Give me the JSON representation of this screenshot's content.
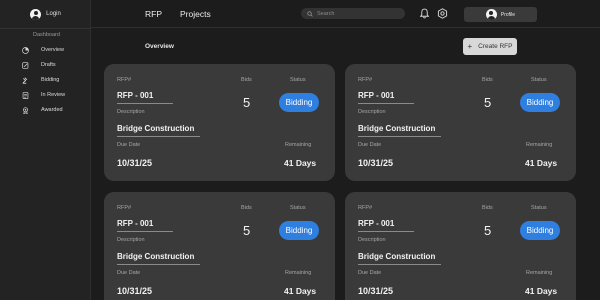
{
  "sidebar": {
    "login_label": "Login",
    "section_label": "Dashboard",
    "items": [
      {
        "label": "Overview",
        "icon": "pie-chart-icon"
      },
      {
        "label": "Drafts",
        "icon": "edit-icon"
      },
      {
        "label": "Bidding",
        "icon": "gavel-icon"
      },
      {
        "label": "In Review",
        "icon": "document-icon"
      },
      {
        "label": "Awarded",
        "icon": "award-icon"
      }
    ]
  },
  "topbar": {
    "tabs": [
      "RFP",
      "Projects"
    ],
    "search_placeholder": "Search",
    "profile_label": "Profile"
  },
  "main": {
    "title": "Overview",
    "create_button_label": "Create RFP",
    "create_button_icon": "+"
  },
  "card_labels": {
    "rfp": "RFP#",
    "bids": "Bids",
    "status": "Status",
    "description": "Description",
    "due_date": "Due Date",
    "remaining": "Remaining"
  },
  "cards": [
    {
      "rfp": "RFP - 001",
      "bids": "5",
      "status": "Bidding",
      "description": "Bridge Construction",
      "due_date": "10/31/25",
      "remaining": "41 Days"
    },
    {
      "rfp": "RFP - 001",
      "bids": "5",
      "status": "Bidding",
      "description": "Bridge Construction",
      "due_date": "10/31/25",
      "remaining": "41 Days"
    },
    {
      "rfp": "RFP - 001",
      "bids": "5",
      "status": "Bidding",
      "description": "Bridge Construction",
      "due_date": "10/31/25",
      "remaining": "41 Days"
    },
    {
      "rfp": "RFP - 001",
      "bids": "5",
      "status": "Bidding",
      "description": "Bridge Construction",
      "due_date": "10/31/25",
      "remaining": "41 Days"
    }
  ],
  "colors": {
    "background": "#1c1c1c",
    "card": "#3a3a3a",
    "status_accent": "#2f7fe0"
  }
}
